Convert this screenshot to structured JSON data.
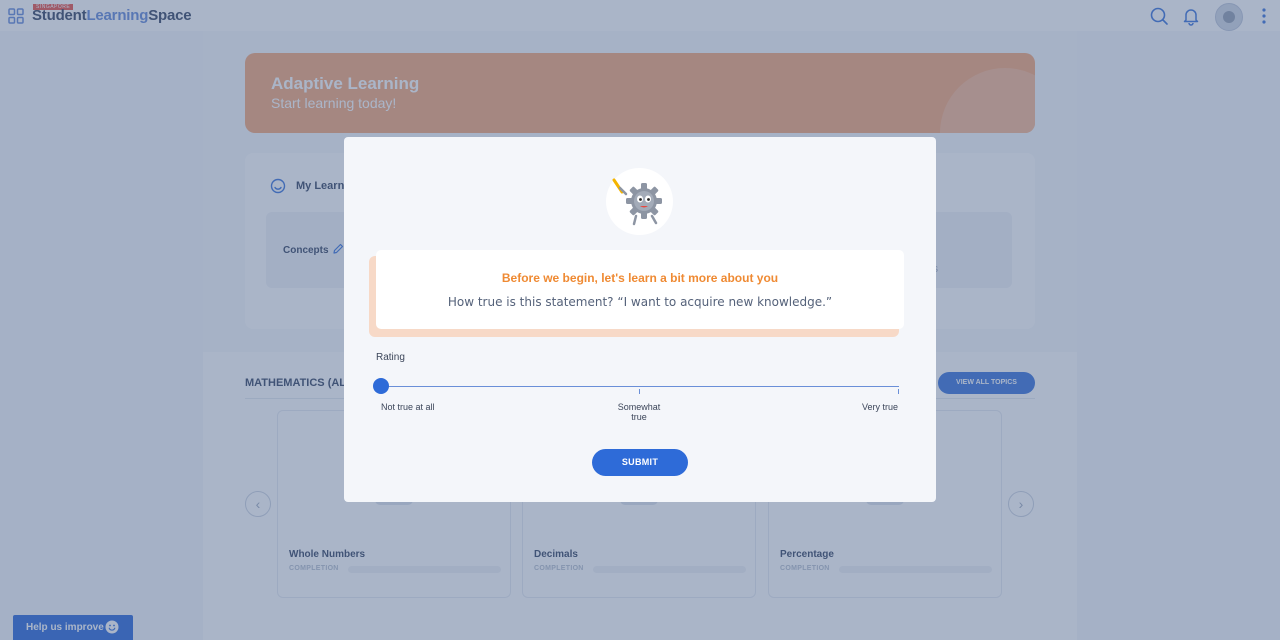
{
  "header": {
    "brand_tag": "SINGAPORE",
    "brand_part1": "Student",
    "brand_part2": "Learning",
    "brand_part3": "Space",
    "icons": [
      "apps-grid-icon",
      "search-icon",
      "bell-icon",
      "avatar",
      "more-vert-icon"
    ]
  },
  "banner": {
    "title": "Adaptive Learning",
    "subtitle": "Start learning today!"
  },
  "learning": {
    "title": "My Learn",
    "concepts_label": "Concepts",
    "right_fragment": "ions"
  },
  "math": {
    "title": "MATHEMATICS (AL",
    "view_all": "VIEW ALL TOPICS",
    "topics": [
      {
        "name": "Whole Numbers",
        "completion_label": "COMPLETION"
      },
      {
        "name": "Decimals",
        "completion_label": "COMPLETION"
      },
      {
        "name": "Percentage",
        "completion_label": "COMPLETION"
      }
    ]
  },
  "help": {
    "label": "Help us improve"
  },
  "modal": {
    "title": "Before we begin, let's learn a bit more about you",
    "question": "How true is this statement? “I want to acquire new knowledge.”",
    "rating_label": "Rating",
    "scale": {
      "min_label": "Not true at all",
      "mid_label": "Somewhat true",
      "max_label": "Very true",
      "value": 0
    },
    "submit": "SUBMIT"
  },
  "colors": {
    "accent_blue": "#2e6bd8",
    "banner_orange": "#f4a271",
    "question_title_orange": "#ef8a33"
  }
}
